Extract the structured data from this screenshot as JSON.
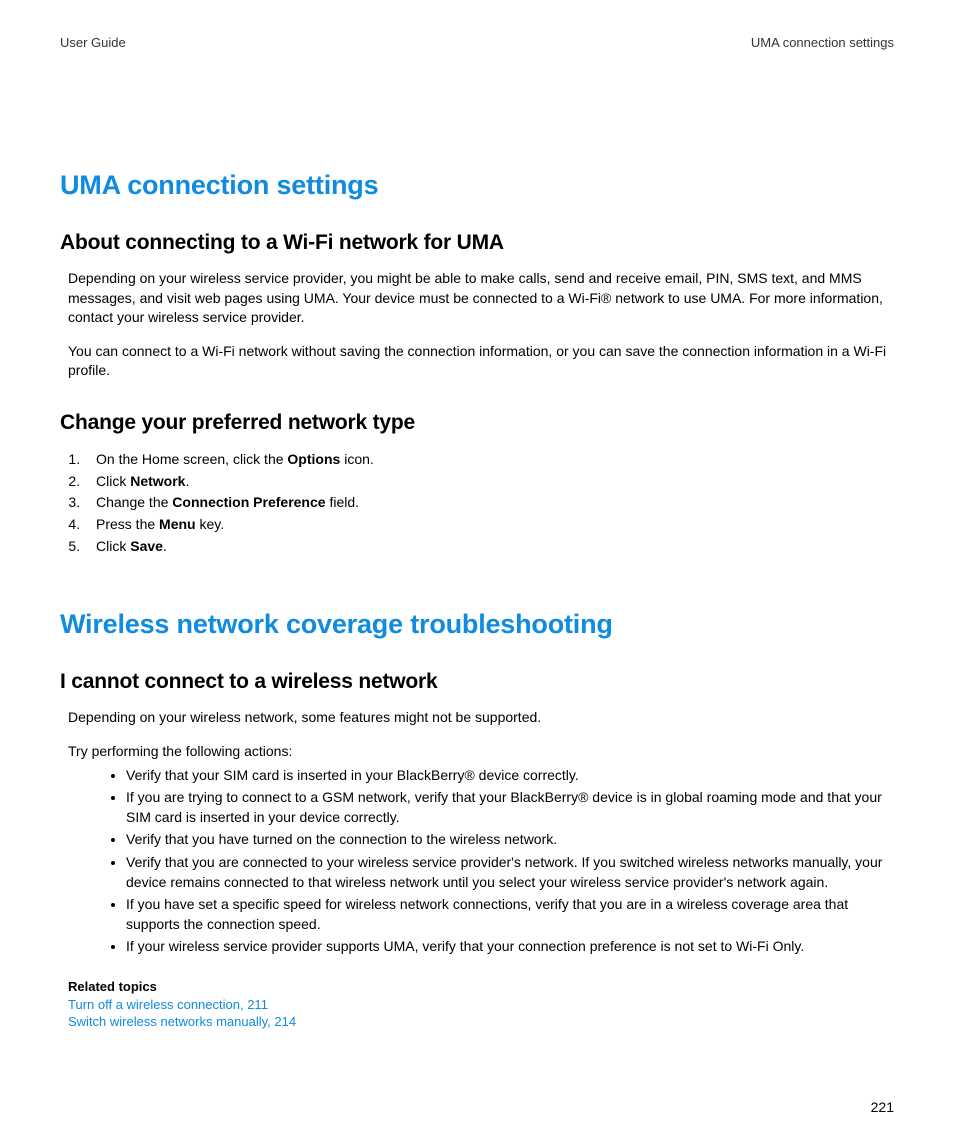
{
  "header": {
    "left": "User Guide",
    "right": "UMA connection settings"
  },
  "section1": {
    "title": "UMA connection settings",
    "sub1": {
      "heading": "About connecting to a Wi-Fi network for UMA",
      "p1": "Depending on your wireless service provider, you might be able to make calls, send and receive email, PIN, SMS text, and MMS messages, and visit web pages using UMA. Your device must be connected to a Wi-Fi® network to use UMA. For more information, contact your wireless service provider.",
      "p2": "You can connect to a Wi-Fi network without saving the connection information, or you can save the connection information in a Wi-Fi profile."
    },
    "sub2": {
      "heading": "Change your preferred network type",
      "steps": [
        {
          "pre": "On the Home screen, click the ",
          "bold": "Options",
          "post": " icon."
        },
        {
          "pre": "Click ",
          "bold": "Network",
          "post": "."
        },
        {
          "pre": "Change the ",
          "bold": "Connection Preference",
          "post": " field."
        },
        {
          "pre": "Press the ",
          "bold": "Menu",
          "post": " key."
        },
        {
          "pre": "Click ",
          "bold": "Save",
          "post": "."
        }
      ]
    }
  },
  "section2": {
    "title": "Wireless network coverage troubleshooting",
    "sub1": {
      "heading": "I cannot connect to a wireless network",
      "p1": "Depending on your wireless network, some features might not be supported.",
      "p2": "Try performing the following actions:",
      "bullets": [
        "Verify that your SIM card is inserted in your BlackBerry® device correctly.",
        "If you are trying to connect to a GSM network, verify that your BlackBerry® device is in global roaming mode and that your SIM card is inserted in your device correctly.",
        "Verify that you have turned on the connection to the wireless network.",
        "Verify that you are connected to your wireless service provider's network. If you switched wireless networks manually, your device remains connected to that wireless network until you select your wireless service provider's network again.",
        "If you have set a specific speed for wireless network connections, verify that you are in a wireless coverage area that supports the connection speed.",
        "If your wireless service provider supports UMA, verify that your connection preference is not set to Wi-Fi Only."
      ]
    },
    "related": {
      "label": "Related topics",
      "links": [
        "Turn off a wireless connection, 211",
        "Switch wireless networks manually, 214"
      ]
    }
  },
  "page_number": "221"
}
